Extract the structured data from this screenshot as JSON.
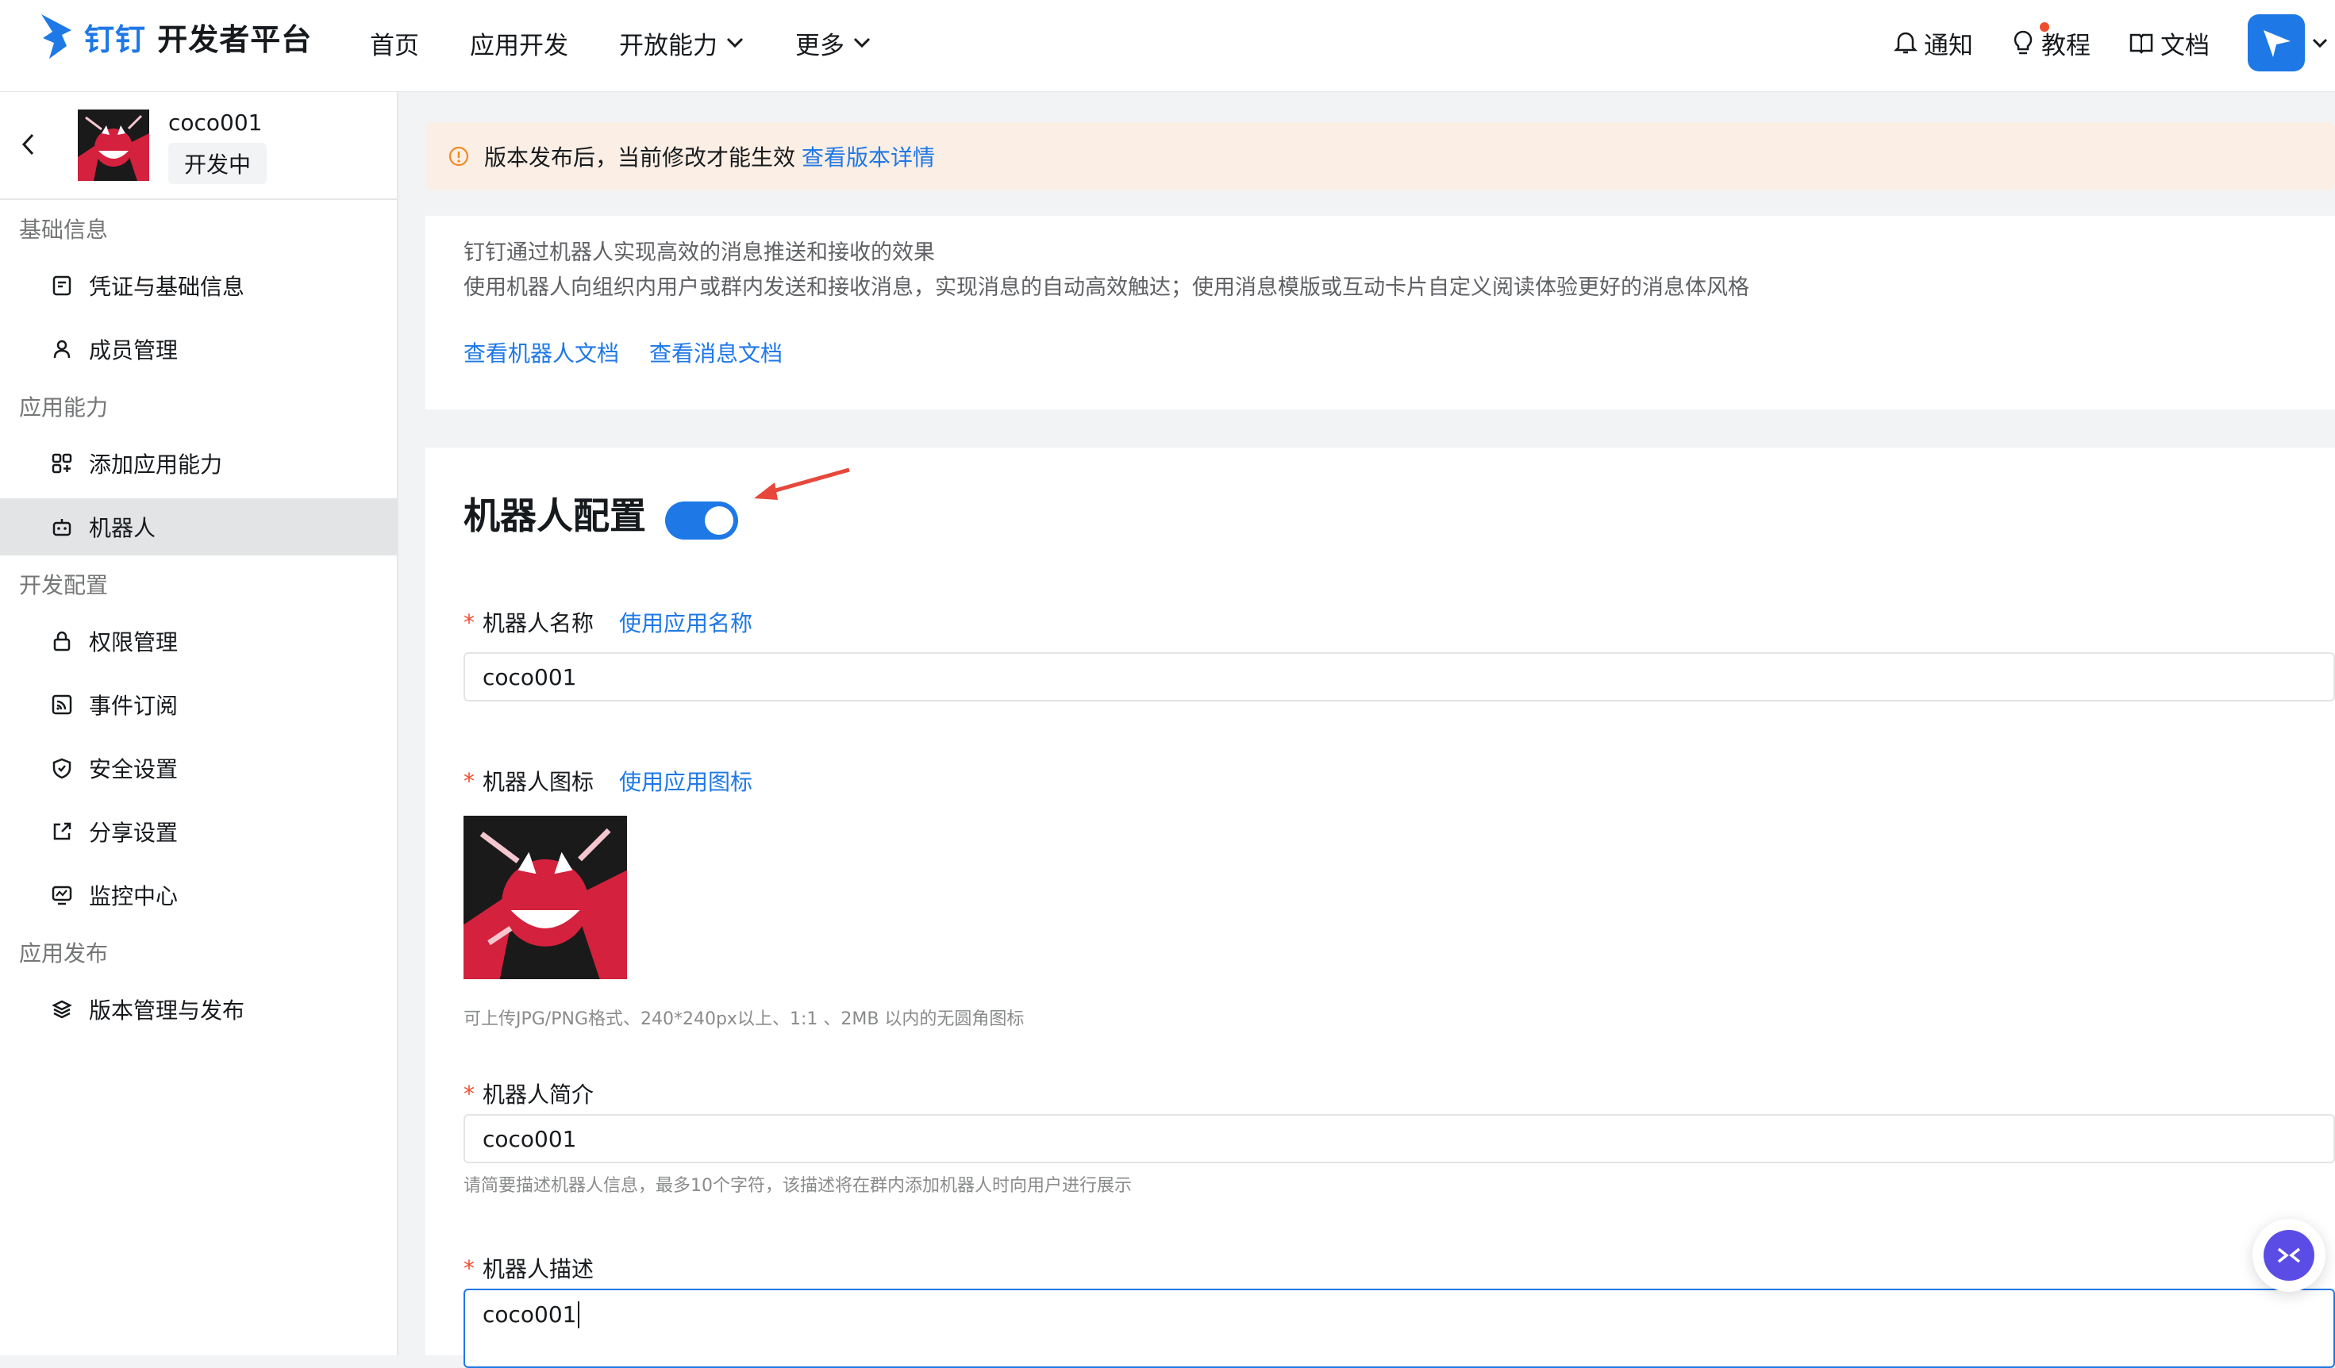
{
  "header": {
    "brand_part": "钉钉",
    "brand_rest": " 开发者平台",
    "nav": [
      {
        "label": "首页"
      },
      {
        "label": "应用开发"
      },
      {
        "label": "开放能力"
      },
      {
        "label": "更多"
      }
    ],
    "right_links": [
      {
        "label": "通知",
        "icon": "bell-icon"
      },
      {
        "label": "教程",
        "icon": "bulb-icon"
      },
      {
        "label": "文档",
        "icon": "book-icon"
      }
    ]
  },
  "sidebar": {
    "app_name": "coco001",
    "app_status": "开发中",
    "groups": [
      {
        "title": "基础信息",
        "items": [
          {
            "label": "凭证与基础信息"
          },
          {
            "label": "成员管理"
          }
        ]
      },
      {
        "title": "应用能力",
        "items": [
          {
            "label": "添加应用能力"
          },
          {
            "label": "机器人"
          }
        ]
      },
      {
        "title": "开发配置",
        "items": [
          {
            "label": "权限管理"
          },
          {
            "label": "事件订阅"
          },
          {
            "label": "安全设置"
          },
          {
            "label": "分享设置"
          },
          {
            "label": "监控中心"
          }
        ]
      },
      {
        "title": "应用发布",
        "items": [
          {
            "label": "版本管理与发布"
          }
        ]
      }
    ],
    "active_item": "机器人"
  },
  "notice": {
    "text": "版本发布后，当前修改才能生效",
    "link": "查看版本详情"
  },
  "intro": {
    "line1": "钉钉通过机器人实现高效的消息推送和接收的效果",
    "line2": "使用机器人向组织内用户或群内发送和接收消息，实现消息的自动高效触达；使用消息模版或互动卡片自定义阅读体验更好的消息体风格",
    "link1": "查看机器人文档",
    "link2": "查看消息文档"
  },
  "config": {
    "title": "机器人配置",
    "enabled": true,
    "required_mark": "*",
    "name_label": "机器人名称",
    "name_link": "使用应用名称",
    "name_value": "coco001",
    "icon_label": "机器人图标",
    "icon_link": "使用应用图标",
    "icon_hint": "可上传JPG/PNG格式、240*240px以上、1:1 、2MB 以内的无圆角图标",
    "intro_label": "机器人简介",
    "intro_value": "coco001",
    "intro_hint": "请简要描述机器人信息，最多10个字符，该描述将在群内添加机器人时向用户进行展示",
    "desc_label": "机器人描述",
    "desc_value": "coco001"
  },
  "colors": {
    "accent": "#1e78e6",
    "notice_bg": "#fbeee4",
    "required": "#f04d2e",
    "arrow": "#e8473b"
  }
}
